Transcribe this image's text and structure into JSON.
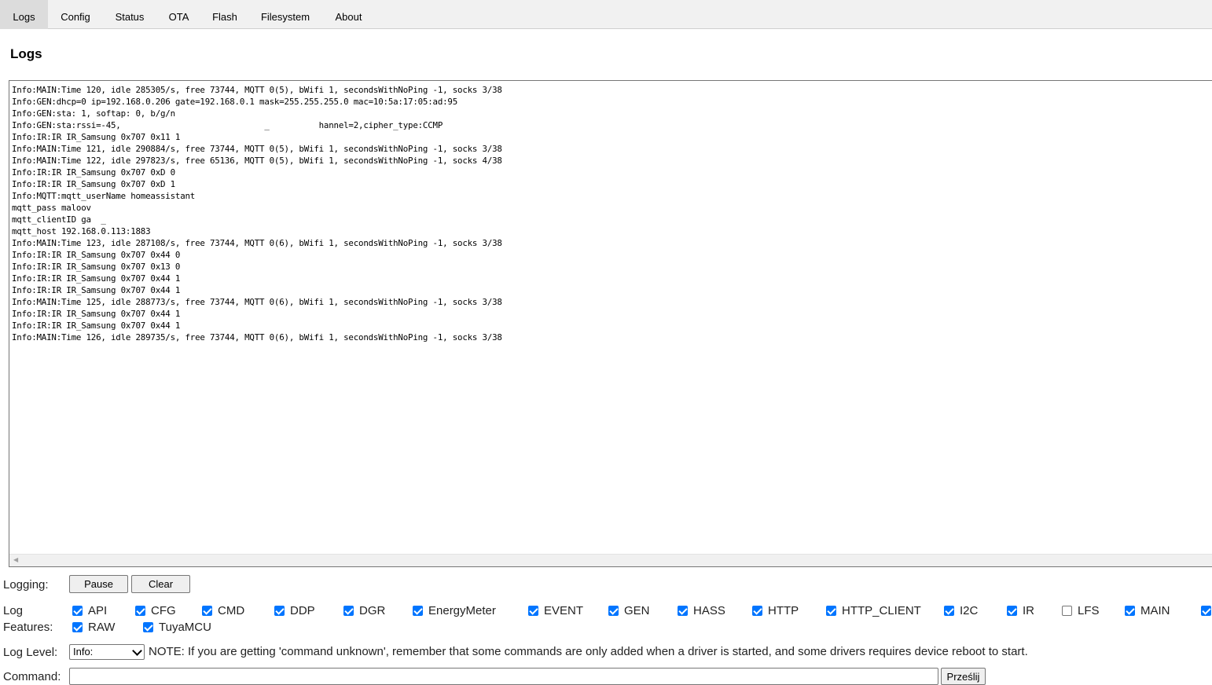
{
  "tabs": [
    {
      "label": "Logs",
      "active": true
    },
    {
      "label": "Config",
      "active": false
    },
    {
      "label": "Status",
      "active": false
    },
    {
      "label": "OTA",
      "active": false
    },
    {
      "label": "Flash",
      "active": false
    },
    {
      "label": "Filesystem",
      "active": false
    },
    {
      "label": "About",
      "active": false
    }
  ],
  "page": {
    "title": "Logs"
  },
  "log": {
    "text": "Info:MAIN:Time 120, idle 285305/s, free 73744, MQTT 0(5), bWifi 1, secondsWithNoPing -1, socks 3/38\nInfo:GEN:dhcp=0 ip=192.168.0.206 gate=192.168.0.1 mask=255.255.255.0 mac=10:5a:17:05:ad:95\nInfo:GEN:sta: 1, softap: 0, b/g/n\nInfo:GEN:sta:rssi=-45,                             _          hannel=2,cipher_type:CCMP\nInfo:IR:IR IR_Samsung 0x707 0x11 1\nInfo:MAIN:Time 121, idle 290884/s, free 73744, MQTT 0(5), bWifi 1, secondsWithNoPing -1, socks 3/38\nInfo:MAIN:Time 122, idle 297823/s, free 65136, MQTT 0(5), bWifi 1, secondsWithNoPing -1, socks 4/38\nInfo:IR:IR IR_Samsung 0x707 0xD 0\nInfo:IR:IR IR_Samsung 0x707 0xD 1\nInfo:MQTT:mqtt_userName homeassistant\nmqtt_pass maloov\nmqtt_clientID ga  _\nmqtt_host 192.168.0.113:1883\nInfo:MAIN:Time 123, idle 287108/s, free 73744, MQTT 0(6), bWifi 1, secondsWithNoPing -1, socks 3/38\nInfo:IR:IR IR_Samsung 0x707 0x44 0\nInfo:IR:IR IR_Samsung 0x707 0x13 0\nInfo:IR:IR IR_Samsung 0x707 0x44 1\nInfo:IR:IR IR_Samsung 0x707 0x44 1\nInfo:MAIN:Time 125, idle 288773/s, free 73744, MQTT 0(6), bWifi 1, secondsWithNoPing -1, socks 3/38\nInfo:IR:IR IR_Samsung 0x707 0x44 1\nInfo:IR:IR IR_Samsung 0x707 0x44 1\nInfo:MAIN:Time 126, idle 289735/s, free 73744, MQTT 0(6), bWifi 1, secondsWithNoPing -1, socks 3/38"
  },
  "logging": {
    "label": "Logging:",
    "pause_label": "Pause",
    "clear_label": "Clear"
  },
  "features": {
    "label_line1": "Log",
    "label_line2": "Features:",
    "items": [
      {
        "name": "API",
        "checked": true
      },
      {
        "name": "CFG",
        "checked": true
      },
      {
        "name": "CMD",
        "checked": true
      },
      {
        "name": "DDP",
        "checked": true
      },
      {
        "name": "DGR",
        "checked": true
      },
      {
        "name": "EnergyMeter",
        "checked": true
      },
      {
        "name": "EVENT",
        "checked": true
      },
      {
        "name": "GEN",
        "checked": true
      },
      {
        "name": "HASS",
        "checked": true
      },
      {
        "name": "HTTP",
        "checked": true
      },
      {
        "name": "HTTP_CLIENT",
        "checked": true
      },
      {
        "name": "I2C",
        "checked": true
      },
      {
        "name": "IR",
        "checked": true
      },
      {
        "name": "LFS",
        "checked": false
      },
      {
        "name": "MAIN",
        "checked": true
      },
      {
        "name": "",
        "checked": true
      },
      {
        "name": "RAW",
        "checked": true
      },
      {
        "name": "TuyaMCU",
        "checked": true
      }
    ]
  },
  "loglevel": {
    "label": "Log Level:",
    "selected": "Info:",
    "note": "NOTE: If you are getting 'command unknown', remember that some commands are only added when a driver is started, and some drivers requires device reboot to start."
  },
  "command": {
    "label": "Command:",
    "value": "",
    "submit_label": "Prześlij"
  }
}
